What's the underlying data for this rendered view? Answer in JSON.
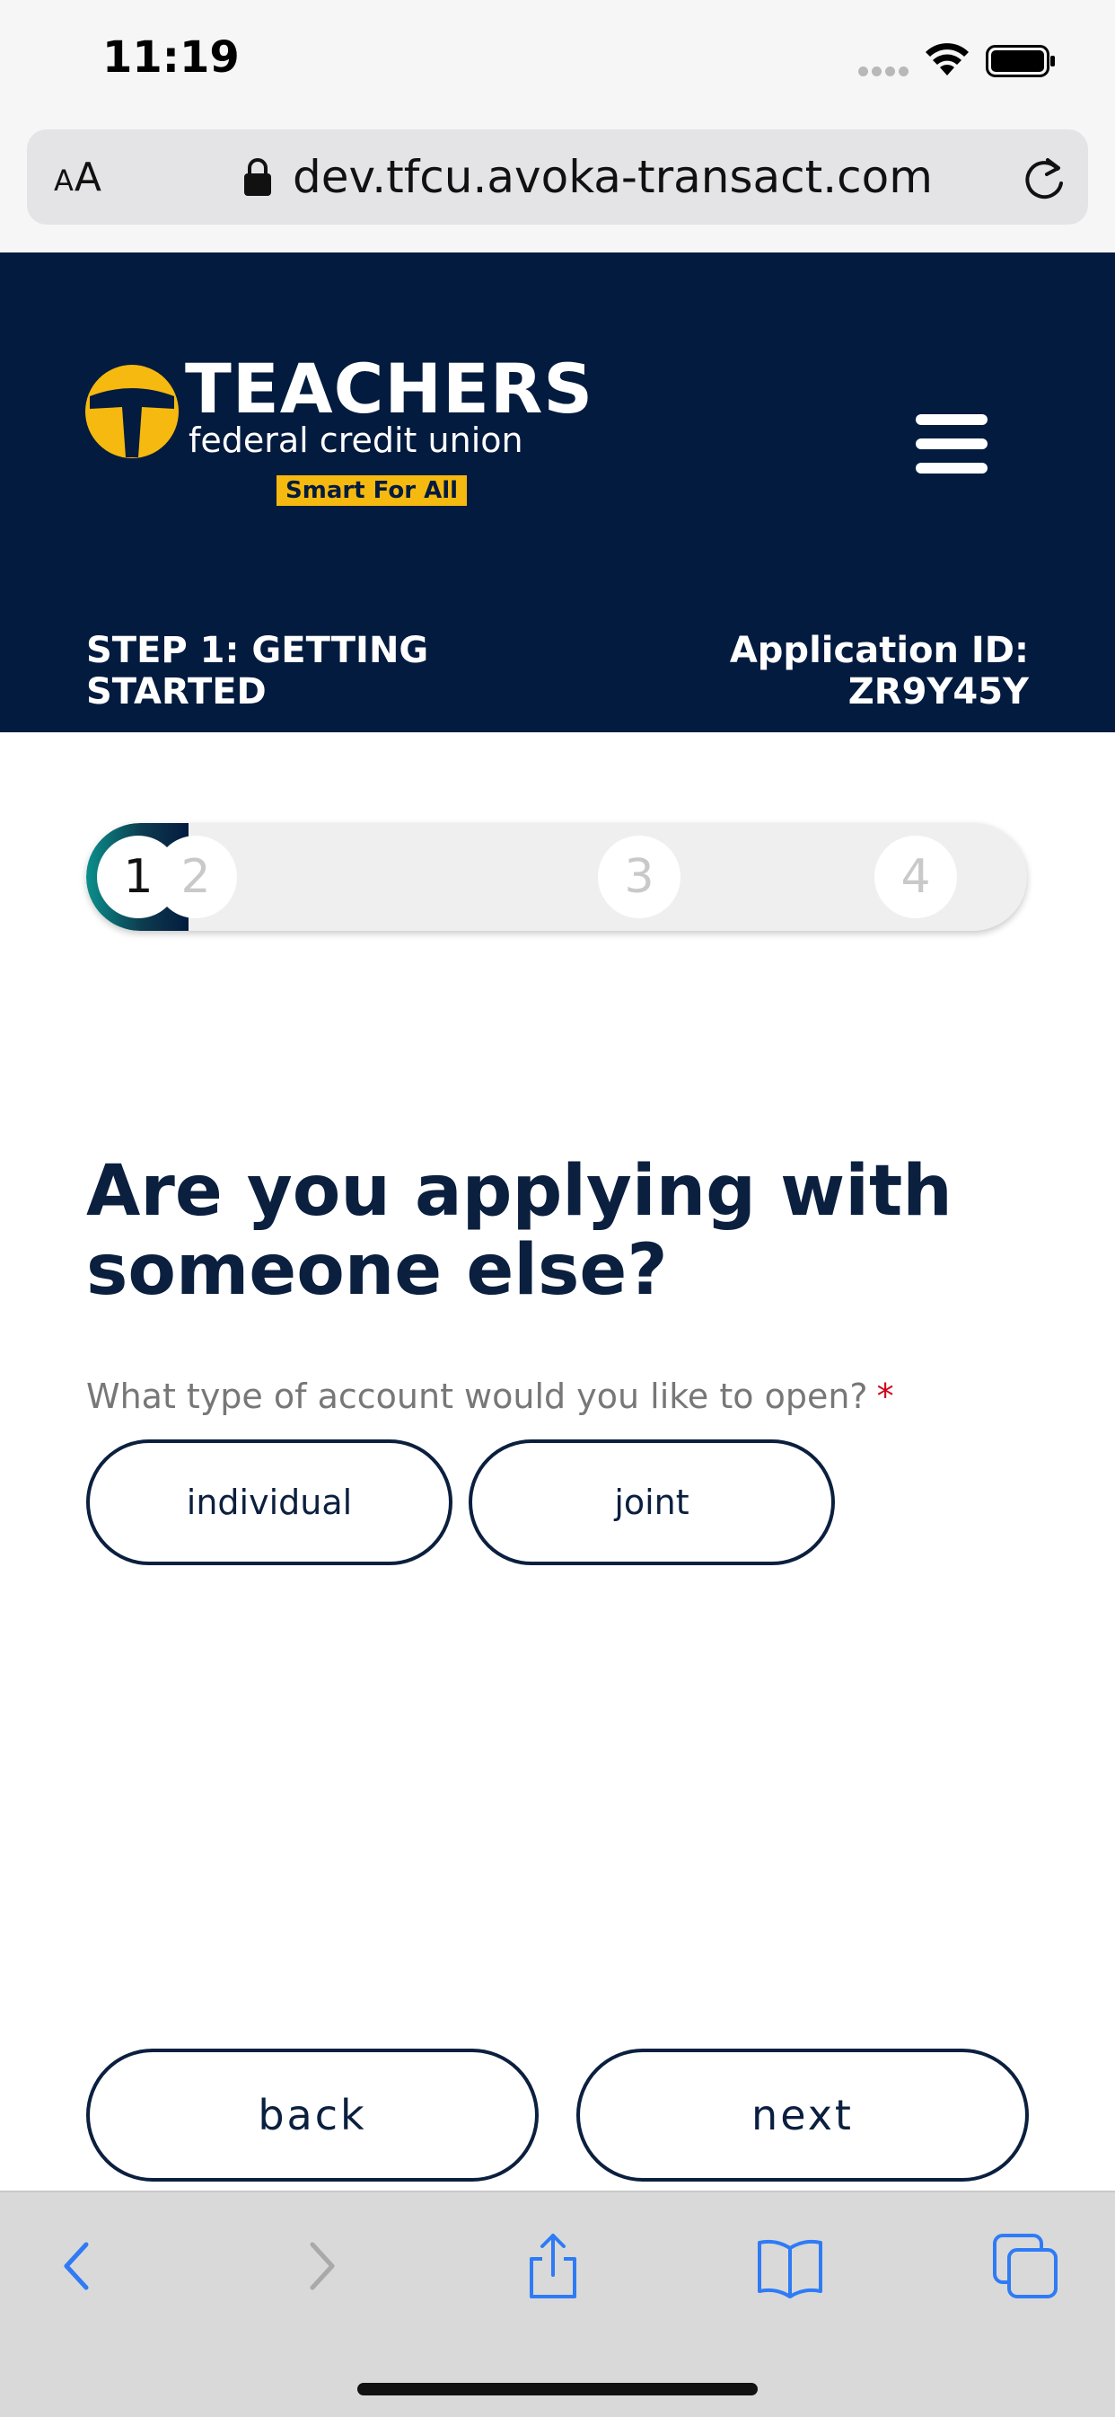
{
  "status_bar": {
    "time": "11:19"
  },
  "browser": {
    "aa_small": "A",
    "aa_large": "A",
    "url": "dev.tfcu.avoka-transact.com"
  },
  "header": {
    "logo_title": "TEACHERS",
    "logo_subtitle": "federal credit union",
    "logo_tagline": "Smart For All",
    "step_label": "STEP 1: GETTING STARTED",
    "app_id_label": "Application ID:",
    "app_id_value": "ZR9Y45Y"
  },
  "progress": {
    "steps": [
      "1",
      "2",
      "3",
      "4"
    ],
    "current_step": 1
  },
  "question": {
    "heading": "Are you applying with someone else?",
    "field_label": "What type of account would you like to open?",
    "required_marker": "*",
    "options": [
      "individual",
      "joint"
    ]
  },
  "navigation": {
    "back_label": "back",
    "next_label": "next"
  },
  "colors": {
    "brand_navy": "#031b3f",
    "brand_gold": "#f6b90f",
    "progress_teal": "#0b8f8c",
    "ios_blue": "#2f7bf5",
    "required_red": "#d0021b"
  },
  "toolbar": {
    "icons": [
      "back-arrow-icon",
      "forward-arrow-icon",
      "share-icon",
      "bookmarks-icon",
      "tabs-icon"
    ]
  }
}
